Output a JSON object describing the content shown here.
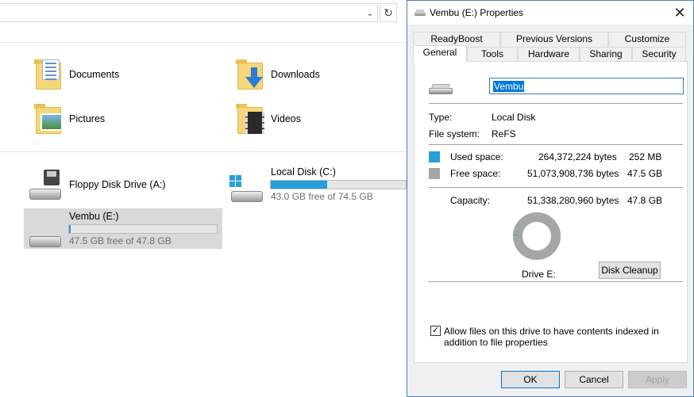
{
  "explorer": {
    "folders": [
      {
        "label": "Documents",
        "icon": "documents-folder-icon"
      },
      {
        "label": "Downloads",
        "icon": "downloads-folder-icon"
      },
      {
        "label": "Pictures",
        "icon": "pictures-folder-icon"
      },
      {
        "label": "Videos",
        "icon": "videos-folder-icon"
      }
    ],
    "drives": [
      {
        "label": "Floppy Disk Drive (A:)",
        "icon": "floppy-drive-icon"
      },
      {
        "label": "Local Disk (C:)",
        "free_text": "43.0 GB free of 74.5 GB",
        "used_fraction": 0.42,
        "icon": "windows-drive-icon"
      },
      {
        "label": "Vembu (E:)",
        "free_text": "47.5 GB free of 47.8 GB",
        "used_fraction": 0.01,
        "icon": "drive-icon"
      }
    ]
  },
  "dialog": {
    "title": "Vembu (E:) Properties",
    "close_glyph": "✕",
    "tabs_row1": [
      "ReadyBoost",
      "Previous Versions",
      "Customize"
    ],
    "tabs_row2": [
      "General",
      "Tools",
      "Hardware",
      "Sharing",
      "Security"
    ],
    "active_tab": "General",
    "general": {
      "name_value": "Vembu",
      "type_label": "Type:",
      "type_value": "Local Disk",
      "fs_label": "File system:",
      "fs_value": "ReFS",
      "used_label": "Used space:",
      "used_bytes": "264,372,224 bytes",
      "used_size": "252 MB",
      "free_label": "Free space:",
      "free_bytes": "51,073,908,736 bytes",
      "free_size": "47.5 GB",
      "capacity_label": "Capacity:",
      "capacity_bytes": "51,338,280,960 bytes",
      "capacity_size": "47.8 GB",
      "drive_caption": "Drive E:",
      "disk_cleanup": "Disk Cleanup",
      "index_checkbox_checked": true,
      "index_checkbox_glyph": "✓",
      "index_text": "Allow files on this drive to have contents indexed in addition to file properties",
      "used_color": "#26a0da",
      "free_color": "#a6a6a6"
    },
    "buttons": {
      "ok": "OK",
      "cancel": "Cancel",
      "apply": "Apply"
    }
  },
  "address_bar": {
    "dropdown_glyph": "⌄",
    "refresh_glyph": "↻"
  }
}
